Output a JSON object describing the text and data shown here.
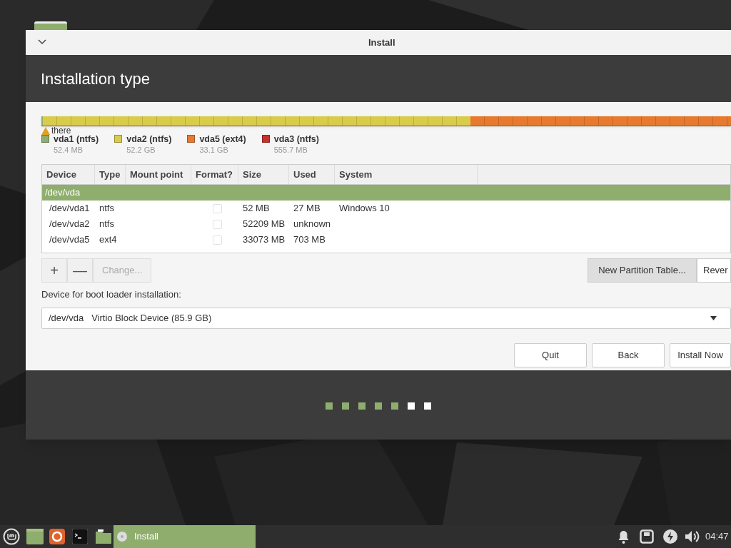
{
  "window": {
    "title": "Install",
    "heading": "Installation type"
  },
  "warning": {
    "text": "there"
  },
  "partitions": [
    {
      "name": "vda1 (ntfs)",
      "size": "52.4 MB",
      "color": "#8fae6e",
      "level": 0.002
    },
    {
      "name": "vda2 (ntfs)",
      "size": "52.2 GB",
      "color": "#d9cc4a",
      "level": 0.62
    },
    {
      "name": "vda5 (ext4)",
      "size": "33.1 GB",
      "color": "#e77a2e",
      "level": 0.378
    },
    {
      "name": "vda3 (ntfs)",
      "size": "555.7 MB",
      "color": "#c8302a"
    }
  ],
  "table": {
    "columns": [
      "Device",
      "Type",
      "Mount point",
      "Format?",
      "Size",
      "Used",
      "System"
    ],
    "rows": [
      {
        "kind": "disk",
        "device": "/dev/vda",
        "selected": true
      },
      {
        "kind": "partition",
        "device": "/dev/vda1",
        "type": "ntfs",
        "format": false,
        "size": "52 MB",
        "used": "27 MB",
        "system": "Windows 10",
        "selected": false
      },
      {
        "kind": "partition",
        "device": "/dev/vda2",
        "type": "ntfs",
        "format": false,
        "size": "52209 MB",
        "used": "unknown",
        "selected": false
      },
      {
        "kind": "partition",
        "device": "/dev/vda5",
        "type": "ext4",
        "format": false,
        "size": "33073 MB",
        "used": "703 MB",
        "selected": false
      }
    ]
  },
  "table_buttons": [
    {
      "kind": "add",
      "label": "+",
      "disabled": false
    },
    {
      "kind": "remove",
      "label": "—",
      "disabled": false
    },
    {
      "kind": "text",
      "label": "Change...",
      "disabled": true
    }
  ],
  "table_actions": [
    {
      "label": "New Partition Table...",
      "pressed": true
    },
    {
      "label": "Rever",
      "pressed": false
    }
  ],
  "boot_loader": {
    "label": "Device for boot loader installation:",
    "device": "/dev/vda",
    "description": "Virtio Block Device (85.9 GB)"
  },
  "buttons": [
    "Quit",
    "Back",
    "Install Now"
  ],
  "steps": [
    {
      "done": true
    },
    {
      "done": true
    },
    {
      "done": true
    },
    {
      "done": true
    },
    {
      "done": true
    },
    {
      "done": false
    },
    {
      "done": false
    }
  ],
  "taskbar": {
    "window": {
      "title": "Install",
      "selected": true
    },
    "clock": "04:47"
  }
}
